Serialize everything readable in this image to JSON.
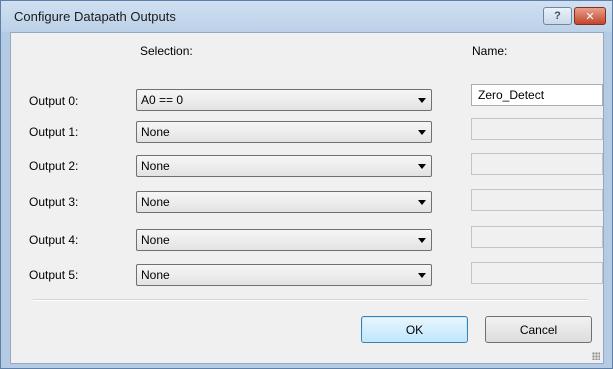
{
  "dialog": {
    "title": "Configure Datapath Outputs",
    "help_glyph": "?",
    "close_glyph": "✕"
  },
  "headers": {
    "selection": "Selection:",
    "name": "Name:"
  },
  "outputs": [
    {
      "label": "Output 0:",
      "selection": "A0 == 0",
      "name": "Zero_Detect",
      "name_enabled": true
    },
    {
      "label": "Output 1:",
      "selection": "None",
      "name": "",
      "name_enabled": false
    },
    {
      "label": "Output 2:",
      "selection": "None",
      "name": "",
      "name_enabled": false
    },
    {
      "label": "Output 3:",
      "selection": "None",
      "name": "",
      "name_enabled": false
    },
    {
      "label": "Output 4:",
      "selection": "None",
      "name": "",
      "name_enabled": false
    },
    {
      "label": "Output 5:",
      "selection": "None",
      "name": "",
      "name_enabled": false
    }
  ],
  "buttons": {
    "ok": "OK",
    "cancel": "Cancel"
  }
}
